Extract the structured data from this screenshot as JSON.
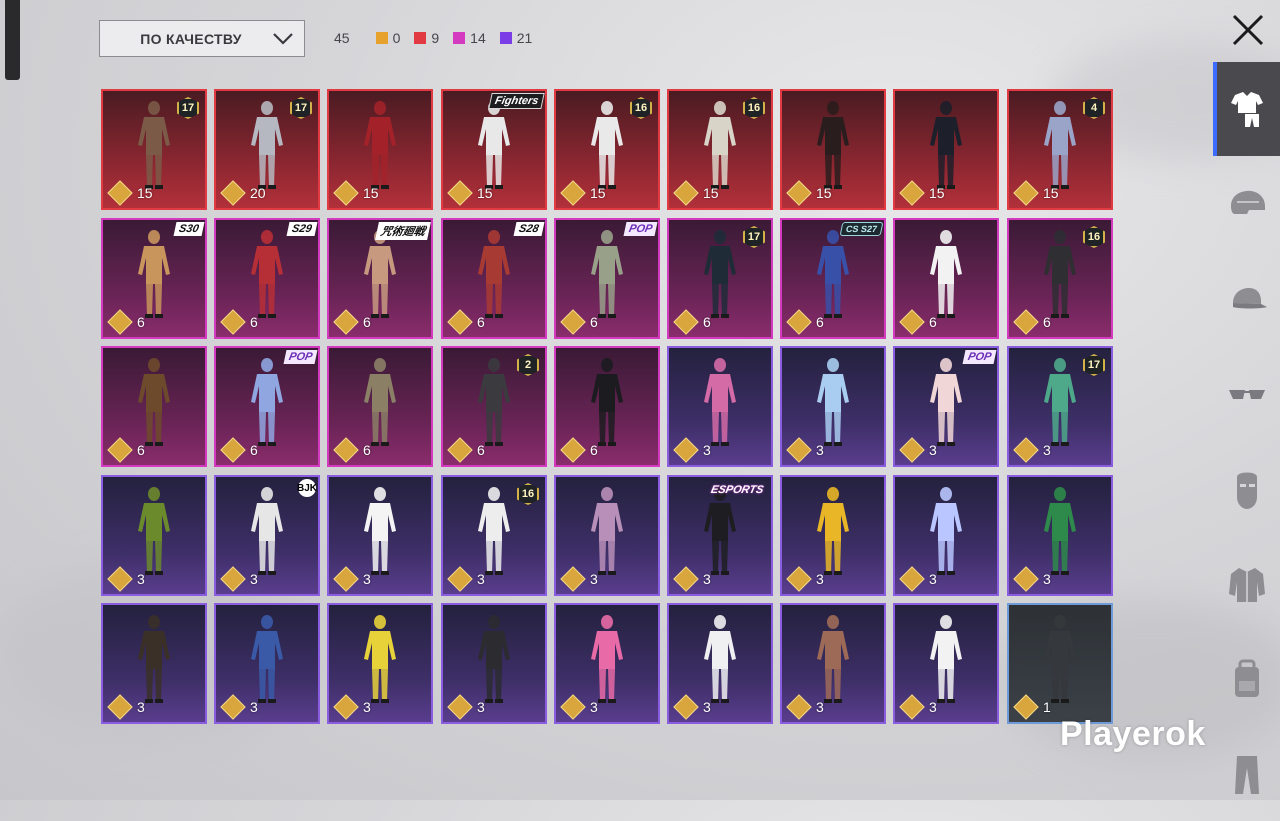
{
  "sort": {
    "label": "ПО КАЧЕСТВУ",
    "icon": "chevron-down-icon"
  },
  "counts": {
    "total": "45",
    "items": [
      {
        "value": "0",
        "color": "#e6a22c"
      },
      {
        "value": "9",
        "color": "#e23a43"
      },
      {
        "value": "14",
        "color": "#d43ac0"
      },
      {
        "value": "21",
        "color": "#7a3de6"
      }
    ]
  },
  "close": {
    "icon": "close-icon"
  },
  "side_tabs": [
    {
      "name": "outfit",
      "icon": "outfit-icon",
      "active": true
    },
    {
      "name": "helmet",
      "icon": "helmet-icon",
      "active": false
    },
    {
      "name": "cap",
      "icon": "cap-icon",
      "active": false
    },
    {
      "name": "glasses",
      "icon": "glasses-icon",
      "active": false
    },
    {
      "name": "mask",
      "icon": "mask-icon",
      "active": false
    },
    {
      "name": "jacket",
      "icon": "jacket-icon",
      "active": false
    },
    {
      "name": "backpack",
      "icon": "backpack-icon",
      "active": false
    },
    {
      "name": "pants",
      "icon": "pants-icon",
      "active": false
    }
  ],
  "items": [
    {
      "q": "red",
      "price": "15",
      "badge": "17",
      "c": "#7b5a48"
    },
    {
      "q": "red",
      "price": "20",
      "badge": "17",
      "c": "#b5b8c0"
    },
    {
      "q": "red",
      "price": "15",
      "badge": "",
      "c": "#a3222a"
    },
    {
      "q": "red",
      "price": "15",
      "tag": "Fighters",
      "c": "#e8e8e8"
    },
    {
      "q": "red",
      "price": "15",
      "badge": "16",
      "c": "#e9e9ea"
    },
    {
      "q": "red",
      "price": "15",
      "badge": "16",
      "c": "#d9d4c8"
    },
    {
      "q": "red",
      "price": "15",
      "badge": "",
      "c": "#2a1d1d"
    },
    {
      "q": "red",
      "price": "15",
      "badge": "",
      "c": "#1d1f2a"
    },
    {
      "q": "red",
      "price": "15",
      "badge": "4",
      "c": "#9aa3c8"
    },
    {
      "q": "pink",
      "price": "6",
      "tag": "S30",
      "c": "#c8955c"
    },
    {
      "q": "pink",
      "price": "6",
      "tag": "S29",
      "c": "#b72f36"
    },
    {
      "q": "pink",
      "price": "6",
      "tag": "咒術廻戦",
      "c": "#c79a80"
    },
    {
      "q": "pink",
      "price": "6",
      "tag": "S28",
      "c": "#a83a34"
    },
    {
      "q": "pink",
      "price": "6",
      "tag": "POP",
      "c": "#98a08a"
    },
    {
      "q": "pink",
      "price": "6",
      "badge": "17",
      "c": "#1f2c38"
    },
    {
      "q": "pink",
      "price": "6",
      "tag": "CS S27",
      "c": "#3850a8"
    },
    {
      "q": "pink",
      "price": "6",
      "badge": "",
      "c": "#f2f2f2"
    },
    {
      "q": "pink",
      "price": "6",
      "badge": "16",
      "c": "#2e2e33"
    },
    {
      "q": "pink",
      "price": "6",
      "badge": "",
      "c": "#6e4a2c"
    },
    {
      "q": "pink",
      "price": "6",
      "tag": "POP",
      "c": "#8fa6e0"
    },
    {
      "q": "pink",
      "price": "6",
      "badge": "",
      "c": "#8b7f66"
    },
    {
      "q": "pink",
      "price": "6",
      "badge": "2",
      "c": "#3b3b3f"
    },
    {
      "q": "pink",
      "price": "6",
      "badge": "",
      "c": "#1c1c20"
    },
    {
      "q": "purple",
      "price": "3",
      "badge": "",
      "c": "#d46aa6"
    },
    {
      "q": "purple",
      "price": "3",
      "badge": "",
      "c": "#a9cdf0"
    },
    {
      "q": "purple",
      "price": "3",
      "tag": "POP",
      "c": "#f0d6d6"
    },
    {
      "q": "purple",
      "price": "3",
      "badge": "17",
      "c": "#4ea88a"
    },
    {
      "q": "purple",
      "price": "3",
      "badge": "",
      "c": "#6b8a2c"
    },
    {
      "q": "purple",
      "price": "3",
      "tag": "BJK",
      "c": "#e6e6e6"
    },
    {
      "q": "purple",
      "price": "3",
      "badge": "",
      "c": "#f4f4f4"
    },
    {
      "q": "purple",
      "price": "3",
      "badge": "16",
      "c": "#ededed"
    },
    {
      "q": "purple",
      "price": "3",
      "badge": "",
      "c": "#b88fb8"
    },
    {
      "q": "purple",
      "price": "3",
      "tag": "ESPORTS",
      "c": "#1e1e22"
    },
    {
      "q": "purple",
      "price": "3",
      "badge": "",
      "c": "#e8b626"
    },
    {
      "q": "purple",
      "price": "3",
      "badge": "",
      "c": "#b9c6ff"
    },
    {
      "q": "purple",
      "price": "3",
      "badge": "",
      "c": "#2e8a4a"
    },
    {
      "q": "purple",
      "price": "3",
      "badge": "",
      "c": "#3a3028"
    },
    {
      "q": "purple",
      "price": "3",
      "badge": "",
      "c": "#3a5aa8"
    },
    {
      "q": "purple",
      "price": "3",
      "badge": "",
      "c": "#e8d23a"
    },
    {
      "q": "purple",
      "price": "3",
      "badge": "",
      "c": "#2b2b30"
    },
    {
      "q": "purple",
      "price": "3",
      "badge": "",
      "c": "#e86aa6"
    },
    {
      "q": "purple",
      "price": "3",
      "badge": "",
      "c": "#f0f0f2"
    },
    {
      "q": "purple",
      "price": "3",
      "badge": "",
      "c": "#9e6a58"
    },
    {
      "q": "purple",
      "price": "3",
      "badge": "",
      "c": "#f2f2f2"
    },
    {
      "q": "grey",
      "price": "1",
      "badge": "",
      "c": "#35383c"
    }
  ],
  "watermark": "Playerok"
}
